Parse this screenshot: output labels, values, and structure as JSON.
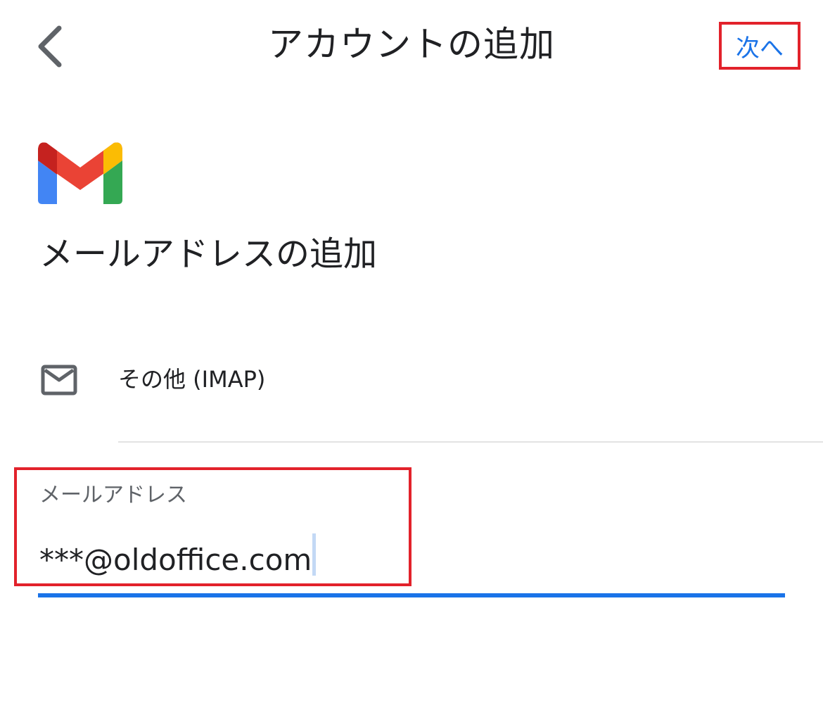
{
  "header": {
    "title": "アカウントの追加",
    "back_icon": "chevron-left-icon",
    "next_label": "次へ"
  },
  "logo": {
    "name": "gmail-logo",
    "colors": {
      "red": "#ea4335",
      "dark_red": "#c5221f",
      "blue": "#4285f4",
      "green": "#34a853",
      "yellow": "#fbbc04"
    }
  },
  "main": {
    "title": "メールアドレスの追加",
    "provider": {
      "icon": "mail-icon",
      "label": "その他 (IMAP)"
    },
    "email_field": {
      "label": "メールアドレス",
      "value": "***@oldoffice.com"
    }
  },
  "colors": {
    "accent": "#1a73e8",
    "highlight_border": "#e2222b",
    "text_primary": "#202124",
    "text_secondary": "#5f6368"
  }
}
